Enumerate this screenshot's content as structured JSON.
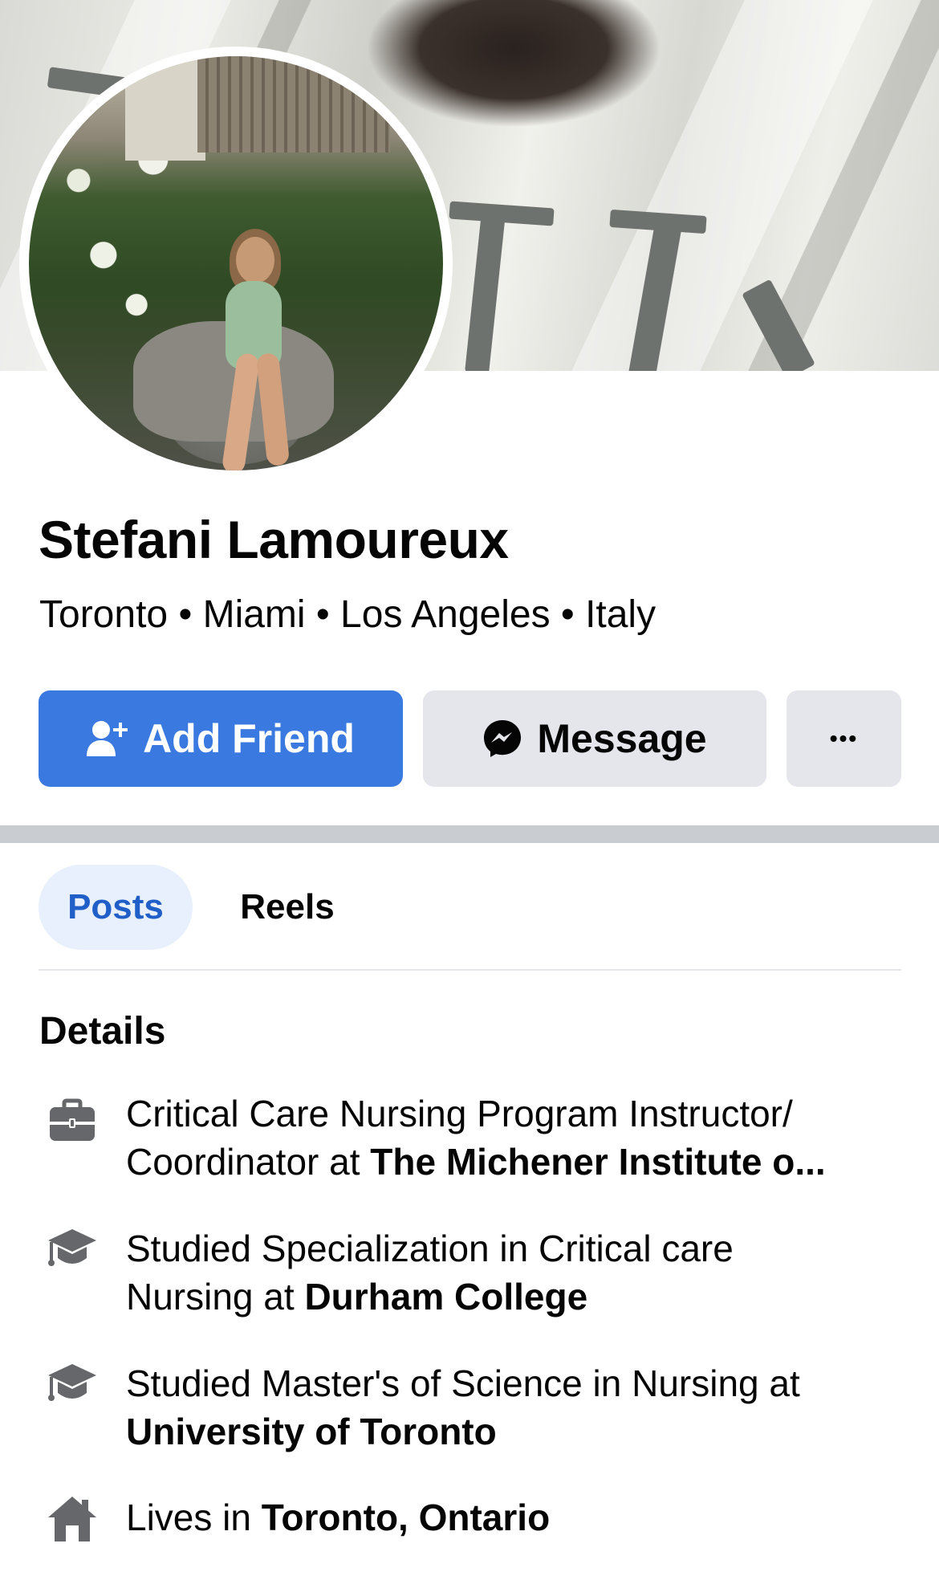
{
  "profile": {
    "name": "Stefani Lamoureux",
    "locations": "Toronto • Miami • Los Angeles • Italy"
  },
  "actions": {
    "add_friend": "Add Friend",
    "message": "Message",
    "more": "•••"
  },
  "tabs": [
    {
      "label": "Posts",
      "active": true
    },
    {
      "label": "Reels",
      "active": false
    }
  ],
  "details": {
    "heading": "Details",
    "items": [
      {
        "icon": "briefcase-icon",
        "line1": "Critical Care Nursing Program Instructor/",
        "prefix": "Coordinator at ",
        "bold": "The Michener Institute o..."
      },
      {
        "icon": "graduation-cap-icon",
        "line1": "Studied Specialization in Critical care",
        "prefix": "Nursing at ",
        "bold": "Durham College"
      },
      {
        "icon": "graduation-cap-icon",
        "line1": "Studied Master's of Science in Nursing at",
        "prefix": "",
        "bold": "University of Toronto"
      },
      {
        "icon": "home-icon",
        "line1": "",
        "prefix": "Lives in ",
        "bold": "Toronto, Ontario"
      }
    ]
  },
  "colors": {
    "primary": "#3a79e0",
    "secondary_button": "#e4e6eb",
    "active_tab_bg": "#e8f0fd",
    "active_tab_text": "#1f5fc7"
  }
}
